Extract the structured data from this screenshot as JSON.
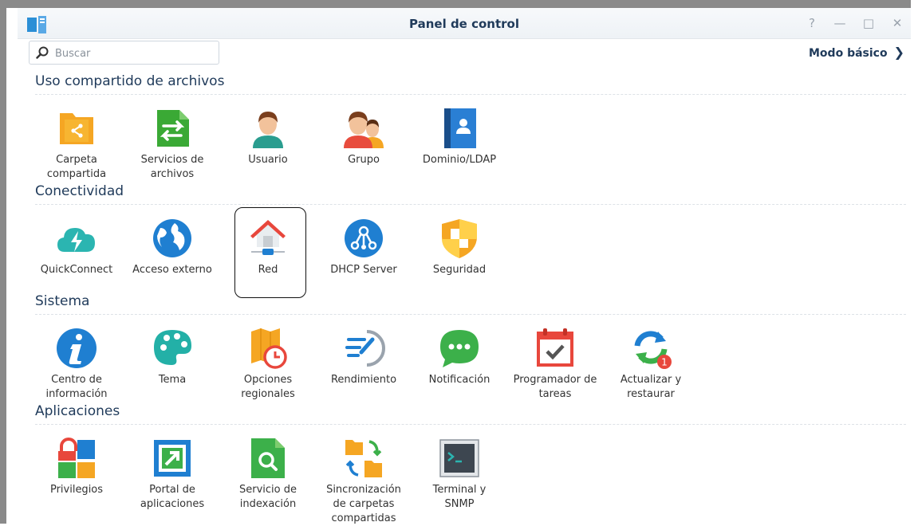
{
  "window": {
    "title": "Panel de control",
    "controls": [
      "?",
      "—",
      "□",
      "✕"
    ]
  },
  "search": {
    "placeholder": "Buscar",
    "value": ""
  },
  "mode_button": {
    "label": "Modo básico"
  },
  "sections": [
    {
      "title": "Uso compartido de archivos",
      "items": [
        {
          "label": "Carpeta\ncompartida",
          "icon": "shared-folder-icon"
        },
        {
          "label": "Servicios de\narchivos",
          "icon": "file-services-icon"
        },
        {
          "label": "Usuario",
          "icon": "user-icon"
        },
        {
          "label": "Grupo",
          "icon": "group-icon"
        },
        {
          "label": "Dominio/LDAP",
          "icon": "domain-ldap-icon"
        }
      ]
    },
    {
      "title": "Conectividad",
      "items": [
        {
          "label": "QuickConnect",
          "icon": "quickconnect-icon"
        },
        {
          "label": "Acceso externo",
          "icon": "external-access-icon"
        },
        {
          "label": "Red",
          "icon": "network-icon"
        },
        {
          "label": "DHCP Server",
          "icon": "dhcp-server-icon"
        },
        {
          "label": "Seguridad",
          "icon": "security-icon"
        }
      ]
    },
    {
      "title": "Sistema",
      "items": [
        {
          "label": "Centro de\ninformación",
          "icon": "info-center-icon"
        },
        {
          "label": "Tema",
          "icon": "theme-icon"
        },
        {
          "label": "Opciones\nregionales",
          "icon": "regional-options-icon"
        },
        {
          "label": "Rendimiento",
          "icon": "performance-icon"
        },
        {
          "label": "Notificación",
          "icon": "notification-icon"
        },
        {
          "label": "Programador de\ntareas",
          "icon": "task-scheduler-icon"
        },
        {
          "label": "Actualizar y\nrestaurar",
          "icon": "update-restore-icon",
          "badge": "1"
        }
      ]
    },
    {
      "title": "Aplicaciones",
      "items": [
        {
          "label": "Privilegios",
          "icon": "privileges-icon"
        },
        {
          "label": "Portal de\naplicaciones",
          "icon": "application-portal-icon"
        },
        {
          "label": "Servicio de\nindexación",
          "icon": "indexing-service-icon"
        },
        {
          "label": "Sincronización\nde carpetas\ncompartidas",
          "icon": "shared-folder-sync-icon"
        },
        {
          "label": "Terminal y\nSNMP",
          "icon": "terminal-snmp-icon"
        }
      ]
    }
  ],
  "selected_item": "Red"
}
